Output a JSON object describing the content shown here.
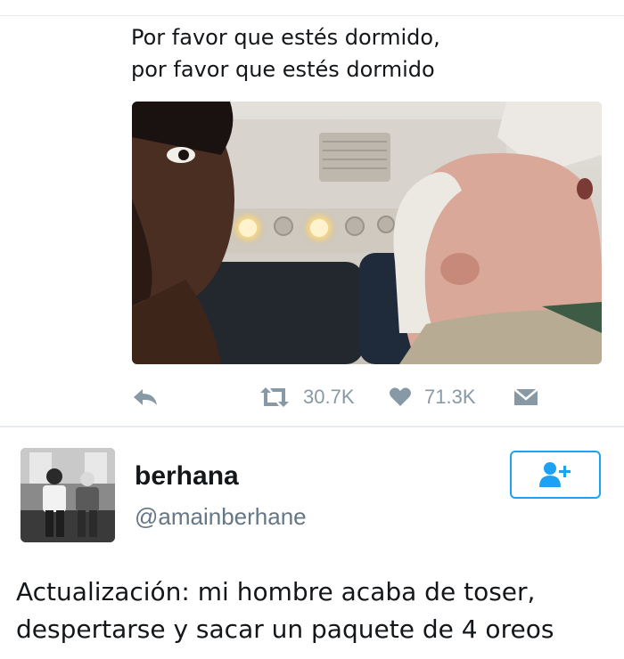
{
  "tweet1": {
    "text_lines": [
      "Por favor que estés dormido,",
      "por favor que estés dormido"
    ],
    "photo": {
      "icon": "airplane-selfie-photo"
    },
    "actions": {
      "reply_icon": "reply-icon",
      "retweet_icon": "retweet-icon",
      "retweets": "30.7K",
      "like_icon": "heart-icon",
      "likes": "71.3K",
      "dm_icon": "envelope-icon"
    }
  },
  "tweet2": {
    "author": {
      "name": "berhana",
      "handle": "@amainberhane"
    },
    "follow_icon": "follow-user-plus-icon",
    "text_lines": [
      "Actualización: mi hombre acaba de toser,",
      "despertarse y sacar un paquete de 4 oreos"
    ]
  },
  "colors": {
    "twitter_blue": "#1da1f2",
    "muted_gray": "#8899a6",
    "text": "#14171a",
    "handle_gray": "#657786"
  }
}
